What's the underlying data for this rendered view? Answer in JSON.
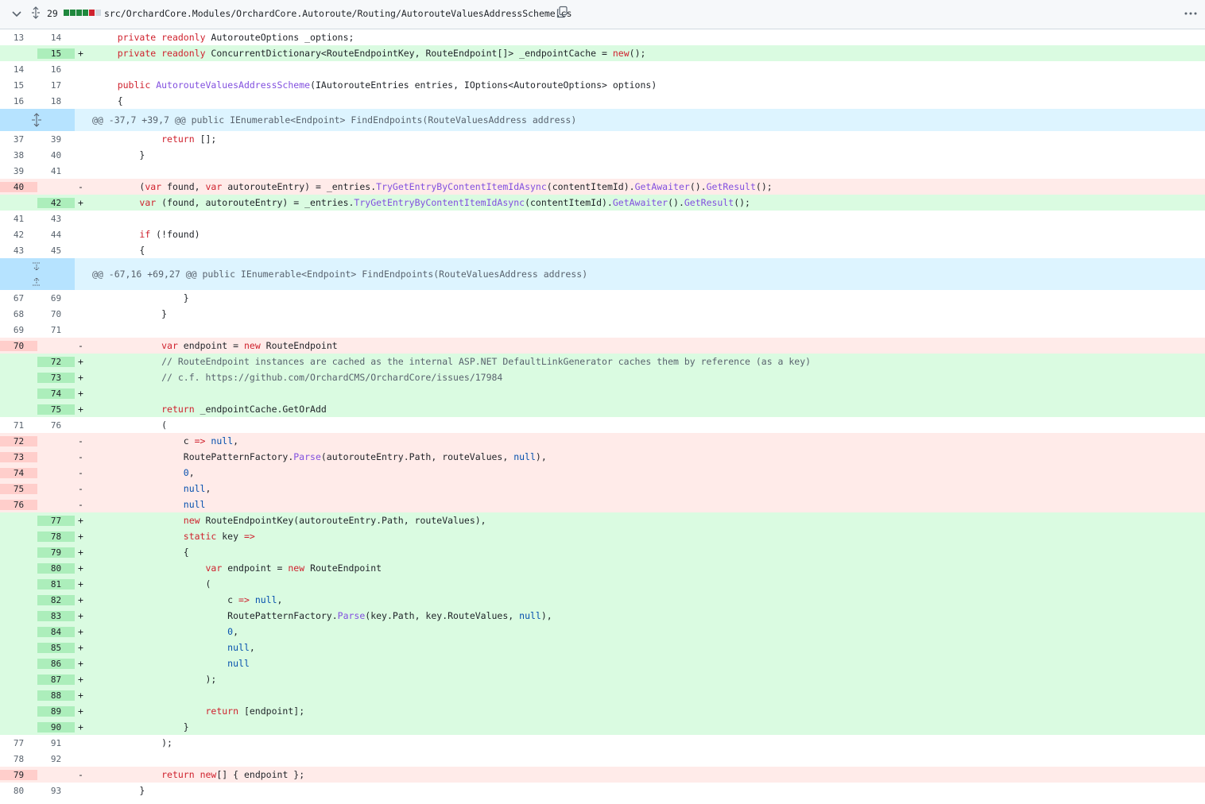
{
  "file_header": {
    "changes_count": "29",
    "file_path": "src/OrchardCore.Modules/OrchardCore.Autoroute/Routing/AutorouteValuesAddressScheme.cs",
    "diffstat": [
      "add",
      "add",
      "add",
      "add",
      "del",
      "neutral"
    ]
  },
  "colors": {
    "add_bg": "#dafbe1",
    "add_num": "#aceebb",
    "del_bg": "#ffebe9",
    "del_num": "#ffcecb",
    "hunk_bg": "#ddf4ff",
    "hunk_gutter": "#b6e3ff"
  },
  "hunks": [
    {
      "header": "@@ -37,7 +39,7 @@ public IEnumerable<Endpoint> FindEndpoints(RouteValuesAddress address)"
    },
    {
      "header": "@@ -67,16 +69,27 @@ public IEnumerable<Endpoint> FindEndpoints(RouteValuesAddress address)"
    }
  ],
  "lines": [
    {
      "t": "ctx",
      "o": "13",
      "n": "14",
      "c": "    private readonly AutorouteOptions _options;"
    },
    {
      "t": "add",
      "o": "",
      "n": "15",
      "c": "    private readonly ConcurrentDictionary<RouteEndpointKey, RouteEndpoint[]> _endpointCache = new();"
    },
    {
      "t": "ctx",
      "o": "14",
      "n": "16",
      "c": ""
    },
    {
      "t": "ctx",
      "o": "15",
      "n": "17",
      "c": "    public AutorouteValuesAddressScheme(IAutorouteEntries entries, IOptions<AutorouteOptions> options)"
    },
    {
      "t": "ctx",
      "o": "16",
      "n": "18",
      "c": "    {"
    },
    {
      "t": "hunk",
      "h": 0
    },
    {
      "t": "ctx",
      "o": "37",
      "n": "39",
      "c": "            return [];"
    },
    {
      "t": "ctx",
      "o": "38",
      "n": "40",
      "c": "        }"
    },
    {
      "t": "ctx",
      "o": "39",
      "n": "41",
      "c": ""
    },
    {
      "t": "del",
      "o": "40",
      "n": "",
      "c": "        (var found, var autorouteEntry) = _entries.TryGetEntryByContentItemIdAsync(contentItemId).GetAwaiter().GetResult();"
    },
    {
      "t": "add",
      "o": "",
      "n": "42",
      "c": "        var (found, autorouteEntry) = _entries.TryGetEntryByContentItemIdAsync(contentItemId).GetAwaiter().GetResult();"
    },
    {
      "t": "ctx",
      "o": "41",
      "n": "43",
      "c": ""
    },
    {
      "t": "ctx",
      "o": "42",
      "n": "44",
      "c": "        if (!found)"
    },
    {
      "t": "ctx",
      "o": "43",
      "n": "45",
      "c": "        {"
    },
    {
      "t": "hunk",
      "h": 1
    },
    {
      "t": "ctx",
      "o": "67",
      "n": "69",
      "c": "                }"
    },
    {
      "t": "ctx",
      "o": "68",
      "n": "70",
      "c": "            }"
    },
    {
      "t": "ctx",
      "o": "69",
      "n": "71",
      "c": ""
    },
    {
      "t": "del",
      "o": "70",
      "n": "",
      "c": "            var endpoint = new RouteEndpoint"
    },
    {
      "t": "add",
      "o": "",
      "n": "72",
      "c": "            // RouteEndpoint instances are cached as the internal ASP.NET DefaultLinkGenerator caches them by reference (as a key)"
    },
    {
      "t": "add",
      "o": "",
      "n": "73",
      "c": "            // c.f. https://github.com/OrchardCMS/OrchardCore/issues/17984"
    },
    {
      "t": "add",
      "o": "",
      "n": "74",
      "c": ""
    },
    {
      "t": "add",
      "o": "",
      "n": "75",
      "c": "            return _endpointCache.GetOrAdd"
    },
    {
      "t": "ctx",
      "o": "71",
      "n": "76",
      "c": "            ("
    },
    {
      "t": "del",
      "o": "72",
      "n": "",
      "c": "                c => null,"
    },
    {
      "t": "del",
      "o": "73",
      "n": "",
      "c": "                RoutePatternFactory.Parse(autorouteEntry.Path, routeValues, null),"
    },
    {
      "t": "del",
      "o": "74",
      "n": "",
      "c": "                0,"
    },
    {
      "t": "del",
      "o": "75",
      "n": "",
      "c": "                null,"
    },
    {
      "t": "del",
      "o": "76",
      "n": "",
      "c": "                null"
    },
    {
      "t": "add",
      "o": "",
      "n": "77",
      "c": "                new RouteEndpointKey(autorouteEntry.Path, routeValues),"
    },
    {
      "t": "add",
      "o": "",
      "n": "78",
      "c": "                static key =>"
    },
    {
      "t": "add",
      "o": "",
      "n": "79",
      "c": "                {"
    },
    {
      "t": "add",
      "o": "",
      "n": "80",
      "c": "                    var endpoint = new RouteEndpoint"
    },
    {
      "t": "add",
      "o": "",
      "n": "81",
      "c": "                    ("
    },
    {
      "t": "add",
      "o": "",
      "n": "82",
      "c": "                        c => null,"
    },
    {
      "t": "add",
      "o": "",
      "n": "83",
      "c": "                        RoutePatternFactory.Parse(key.Path, key.RouteValues, null),"
    },
    {
      "t": "add",
      "o": "",
      "n": "84",
      "c": "                        0,"
    },
    {
      "t": "add",
      "o": "",
      "n": "85",
      "c": "                        null,"
    },
    {
      "t": "add",
      "o": "",
      "n": "86",
      "c": "                        null"
    },
    {
      "t": "add",
      "o": "",
      "n": "87",
      "c": "                    );"
    },
    {
      "t": "add",
      "o": "",
      "n": "88",
      "c": ""
    },
    {
      "t": "add",
      "o": "",
      "n": "89",
      "c": "                    return [endpoint];"
    },
    {
      "t": "add",
      "o": "",
      "n": "90",
      "c": "                }"
    },
    {
      "t": "ctx",
      "o": "77",
      "n": "91",
      "c": "            );"
    },
    {
      "t": "ctx",
      "o": "78",
      "n": "92",
      "c": ""
    },
    {
      "t": "del",
      "o": "79",
      "n": "",
      "c": "            return new[] { endpoint };"
    },
    {
      "t": "ctx",
      "o": "80",
      "n": "93",
      "c": "        }"
    }
  ]
}
